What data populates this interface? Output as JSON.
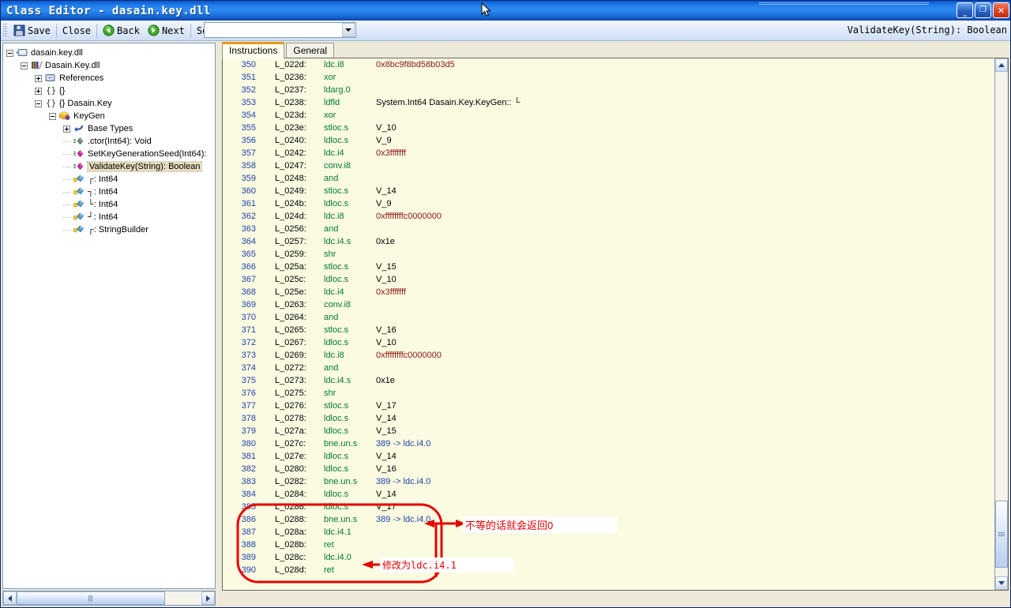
{
  "window": {
    "title": "Class Editor - dasain.key.dll",
    "buttons": {
      "minimize": "_",
      "maximize": "❐",
      "close": "✕"
    }
  },
  "toolbar": {
    "save_label": "Save",
    "close_label": "Close",
    "back_label": "Back",
    "next_label": "Next",
    "search_label": "Search",
    "combo_value": "",
    "combo_placeholder": "",
    "context_label": "ValidateKey(String): Boolean"
  },
  "tree": {
    "items": [
      {
        "indent": 0,
        "expander": "minus",
        "icon": "assembly-file-icon",
        "label": "dasain.key.dll",
        "selected": false
      },
      {
        "indent": 1,
        "expander": "minus",
        "icon": "library-icon",
        "label": "Dasain.Key.dll",
        "selected": false
      },
      {
        "indent": 2,
        "expander": "plus",
        "icon": "references-icon",
        "label": "References",
        "selected": false
      },
      {
        "indent": 2,
        "expander": "plus",
        "icon": "namespace-icon",
        "label": "{}",
        "selected": false
      },
      {
        "indent": 2,
        "expander": "minus",
        "icon": "namespace-icon",
        "label": "{} Dasain.Key",
        "selected": false
      },
      {
        "indent": 3,
        "expander": "minus",
        "icon": "class-icon",
        "label": "KeyGen",
        "selected": false
      },
      {
        "indent": 4,
        "expander": "plus",
        "icon": "base-types-icon",
        "label": "Base Types",
        "selected": false
      },
      {
        "indent": 4,
        "expander": "none",
        "icon": "method-internal-icon",
        "label": ".ctor(Int64): Void",
        "selected": false
      },
      {
        "indent": 4,
        "expander": "none",
        "icon": "method-public-icon",
        "label": "SetKeyGenerationSeed(Int64):",
        "selected": false
      },
      {
        "indent": 4,
        "expander": "none",
        "icon": "method-public-icon",
        "label": "ValidateKey(String): Boolean",
        "selected": true
      },
      {
        "indent": 4,
        "expander": "none",
        "icon": "field-icon",
        "label": "┌: Int64",
        "selected": false
      },
      {
        "indent": 4,
        "expander": "none",
        "icon": "field-icon",
        "label": "┐: Int64",
        "selected": false
      },
      {
        "indent": 4,
        "expander": "none",
        "icon": "field-icon",
        "label": "└: Int64",
        "selected": false
      },
      {
        "indent": 4,
        "expander": "none",
        "icon": "field-icon",
        "label": "┘: Int64",
        "selected": false
      },
      {
        "indent": 4,
        "expander": "none",
        "icon": "field-icon",
        "label": "┌: StringBuilder",
        "selected": false
      }
    ]
  },
  "tabs": [
    {
      "label": "Instructions",
      "active": true
    },
    {
      "label": "General",
      "active": false
    }
  ],
  "instructions": {
    "columns": [
      "#",
      "Offset",
      "OpCode",
      "Operand"
    ],
    "rows": [
      {
        "num": "350",
        "label": "L_022d:",
        "op": "ldc.i8",
        "arg": "0x8bc9f8bd58b03d5",
        "argtype": "hex"
      },
      {
        "num": "351",
        "label": "L_0236:",
        "op": "xor",
        "arg": "",
        "argtype": "plain"
      },
      {
        "num": "352",
        "label": "L_0237:",
        "op": "ldarg.0",
        "arg": "",
        "argtype": "plain"
      },
      {
        "num": "353",
        "label": "L_0238:",
        "op": "ldfld",
        "arg": "System.Int64 Dasain.Key.KeyGen:: └",
        "argtype": "plain"
      },
      {
        "num": "354",
        "label": "L_023d:",
        "op": "xor",
        "arg": "",
        "argtype": "plain"
      },
      {
        "num": "355",
        "label": "L_023e:",
        "op": "stloc.s",
        "arg": "V_10",
        "argtype": "plain"
      },
      {
        "num": "356",
        "label": "L_0240:",
        "op": "ldloc.s",
        "arg": "V_9",
        "argtype": "plain"
      },
      {
        "num": "357",
        "label": "L_0242:",
        "op": "ldc.i4",
        "arg": "0x3fffffff",
        "argtype": "hex"
      },
      {
        "num": "358",
        "label": "L_0247:",
        "op": "conv.i8",
        "arg": "",
        "argtype": "plain"
      },
      {
        "num": "359",
        "label": "L_0248:",
        "op": "and",
        "arg": "",
        "argtype": "plain"
      },
      {
        "num": "360",
        "label": "L_0249:",
        "op": "stloc.s",
        "arg": "V_14",
        "argtype": "plain"
      },
      {
        "num": "361",
        "label": "L_024b:",
        "op": "ldloc.s",
        "arg": "V_9",
        "argtype": "plain"
      },
      {
        "num": "362",
        "label": "L_024d:",
        "op": "ldc.i8",
        "arg": "0xffffffffc0000000",
        "argtype": "hex"
      },
      {
        "num": "363",
        "label": "L_0256:",
        "op": "and",
        "arg": "",
        "argtype": "plain"
      },
      {
        "num": "364",
        "label": "L_0257:",
        "op": "ldc.i4.s",
        "arg": "0x1e",
        "argtype": "plain"
      },
      {
        "num": "365",
        "label": "L_0259:",
        "op": "shr",
        "arg": "",
        "argtype": "plain"
      },
      {
        "num": "366",
        "label": "L_025a:",
        "op": "stloc.s",
        "arg": "V_15",
        "argtype": "plain"
      },
      {
        "num": "367",
        "label": "L_025c:",
        "op": "ldloc.s",
        "arg": "V_10",
        "argtype": "plain"
      },
      {
        "num": "368",
        "label": "L_025e:",
        "op": "ldc.i4",
        "arg": "0x3fffffff",
        "argtype": "hex"
      },
      {
        "num": "369",
        "label": "L_0263:",
        "op": "conv.i8",
        "arg": "",
        "argtype": "plain"
      },
      {
        "num": "370",
        "label": "L_0264:",
        "op": "and",
        "arg": "",
        "argtype": "plain"
      },
      {
        "num": "371",
        "label": "L_0265:",
        "op": "stloc.s",
        "arg": "V_16",
        "argtype": "plain"
      },
      {
        "num": "372",
        "label": "L_0267:",
        "op": "ldloc.s",
        "arg": "V_10",
        "argtype": "plain"
      },
      {
        "num": "373",
        "label": "L_0269:",
        "op": "ldc.i8",
        "arg": "0xffffffffc0000000",
        "argtype": "hex"
      },
      {
        "num": "374",
        "label": "L_0272:",
        "op": "and",
        "arg": "",
        "argtype": "plain"
      },
      {
        "num": "375",
        "label": "L_0273:",
        "op": "ldc.i4.s",
        "arg": "0x1e",
        "argtype": "plain"
      },
      {
        "num": "376",
        "label": "L_0275:",
        "op": "shr",
        "arg": "",
        "argtype": "plain"
      },
      {
        "num": "377",
        "label": "L_0276:",
        "op": "stloc.s",
        "arg": "V_17",
        "argtype": "plain"
      },
      {
        "num": "378",
        "label": "L_0278:",
        "op": "ldloc.s",
        "arg": "V_14",
        "argtype": "plain"
      },
      {
        "num": "379",
        "label": "L_027a:",
        "op": "ldloc.s",
        "arg": "V_15",
        "argtype": "plain"
      },
      {
        "num": "380",
        "label": "L_027c:",
        "op": "bne.un.s",
        "arg": "389 -> ldc.i4.0",
        "argtype": "branch"
      },
      {
        "num": "381",
        "label": "L_027e:",
        "op": "ldloc.s",
        "arg": "V_14",
        "argtype": "plain"
      },
      {
        "num": "382",
        "label": "L_0280:",
        "op": "ldloc.s",
        "arg": "V_16",
        "argtype": "plain"
      },
      {
        "num": "383",
        "label": "L_0282:",
        "op": "bne.un.s",
        "arg": "389 -> ldc.i4.0",
        "argtype": "branch"
      },
      {
        "num": "384",
        "label": "L_0284:",
        "op": "ldloc.s",
        "arg": "V_14",
        "argtype": "plain"
      },
      {
        "num": "385",
        "label": "L_0286:",
        "op": "ldloc.s",
        "arg": "V_17",
        "argtype": "plain"
      },
      {
        "num": "386",
        "label": "L_0288:",
        "op": "bne.un.s",
        "arg": "389 -> ldc.i4.0",
        "argtype": "branch"
      },
      {
        "num": "387",
        "label": "L_028a:",
        "op": "ldc.i4.1",
        "arg": "",
        "argtype": "plain"
      },
      {
        "num": "388",
        "label": "L_028b:",
        "op": "ret",
        "arg": "",
        "argtype": "plain"
      },
      {
        "num": "389",
        "label": "L_028c:",
        "op": "ldc.i4.0",
        "arg": "",
        "argtype": "plain"
      },
      {
        "num": "390",
        "label": "L_028d:",
        "op": "ret",
        "arg": "",
        "argtype": "plain"
      }
    ]
  },
  "annotations": {
    "color": "#e60000",
    "note_branch": "不等的话就会返回0",
    "note_patch": "修改为ldc.i4.1"
  }
}
